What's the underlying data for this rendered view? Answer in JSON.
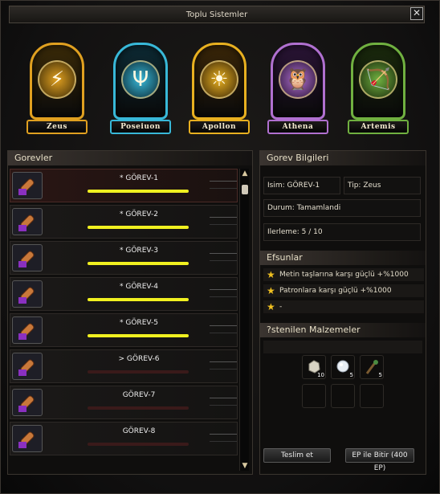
{
  "window": {
    "title": "Toplu Sistemler",
    "close_glyph": "✕"
  },
  "gods": [
    {
      "name": "Zeus",
      "symbol": "⚡",
      "color": "#e0a020",
      "bg": "#3a2a08"
    },
    {
      "name": "Poseiuon",
      "symbol": "Ψ",
      "color": "#38b8d8",
      "bg": "#0c2a34"
    },
    {
      "name": "Apollon",
      "symbol": "☀",
      "color": "#e8b020",
      "bg": "#3a2608"
    },
    {
      "name": "Athena",
      "symbol": "🦉",
      "color": "#b070d0",
      "bg": "#2a1436"
    },
    {
      "name": "Artemis",
      "symbol": "🏹",
      "color": "#70b040",
      "bg": "#1a2a0c"
    }
  ],
  "quests": {
    "header": "Gorevler",
    "items": [
      {
        "label": "* GÖREV-1",
        "progress": 1.0,
        "active": true
      },
      {
        "label": "* GÖREV-2",
        "progress": 1.0,
        "active": false
      },
      {
        "label": "* GÖREV-3",
        "progress": 1.0,
        "active": false
      },
      {
        "label": "* GÖREV-4",
        "progress": 1.0,
        "active": false
      },
      {
        "label": "* GÖREV-5",
        "progress": 1.0,
        "active": false
      },
      {
        "label": "> GÖREV-6",
        "progress": 0,
        "active": false
      },
      {
        "label": "GÖREV-7",
        "progress": 0,
        "active": false
      },
      {
        "label": "GÖREV-8",
        "progress": 0,
        "active": false
      }
    ]
  },
  "details": {
    "header": "Gorev Bilgileri",
    "name": "Isim: GÖREV-1",
    "type": "Tip: Zeus",
    "status": "Durum: Tamamlandi",
    "progress": "Ilerleme: 5 / 10"
  },
  "enchants": {
    "header": "Efsunlar",
    "items": [
      "Metin taşlarına karşı güçlü +%1000",
      "Patronlara karşı güçlü +%1000",
      "-"
    ]
  },
  "materials": {
    "header": "?stenilen Malzemeler",
    "items": [
      {
        "icon": "ore-icon",
        "count": "10"
      },
      {
        "icon": "pearl-icon",
        "count": "5"
      },
      {
        "icon": "herb-icon",
        "count": "5"
      }
    ]
  },
  "actions": {
    "submit": "Teslim et",
    "finish_ep": "EP ile Bitir (400 EP)"
  }
}
